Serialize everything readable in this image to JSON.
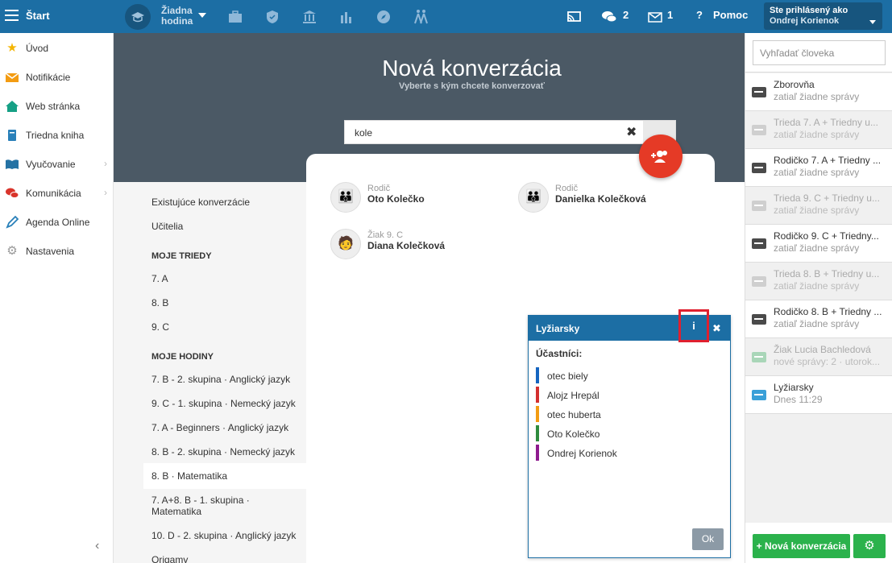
{
  "topbar": {
    "start": "Štart",
    "hodina": [
      "Žiadna",
      "hodina"
    ],
    "messages_count": "2",
    "mail_count": "1",
    "help": "Pomoc",
    "login_label": "Ste prihlásený ako",
    "login_user": "Ondrej Korienok"
  },
  "nav": [
    {
      "label": "Úvod",
      "icon": "star-icon",
      "color": "#f4b400"
    },
    {
      "label": "Notifikácie",
      "icon": "envelope-icon",
      "color": "#f39c12"
    },
    {
      "label": "Web stránka",
      "icon": "home-icon",
      "color": "#16a085"
    },
    {
      "label": "Triedna kniha",
      "icon": "book-icon",
      "color": "#2980b9"
    },
    {
      "label": "Vyučovanie",
      "icon": "open-book-icon",
      "color": "#2472a4"
    },
    {
      "label": "Komunikácia",
      "icon": "chat-icon",
      "color": "#d9342b"
    },
    {
      "label": "Agenda Online",
      "icon": "pen-icon",
      "color": "#2980b9"
    },
    {
      "label": "Nastavenia",
      "icon": "gear-icon",
      "color": "#999999"
    }
  ],
  "hero": {
    "title": "Nová konverzácia",
    "subtitle": "Vyberte s kým chcete konverzovať"
  },
  "search": {
    "value": "kole"
  },
  "sublist": {
    "existing": "Existujúce konverzácie",
    "teachers": "Učitelia",
    "classes_head": "MOJE TRIEDY",
    "classes": [
      "7. A",
      "8. B",
      "9. C"
    ],
    "lessons_head": "MOJE HODINY",
    "lessons": [
      "7. B - 2. skupina · Anglický jazyk",
      "9. C - 1. skupina · Nemecký jazyk",
      "7. A - Beginners · Anglický jazyk",
      "8. B - 2. skupina · Nemecký jazyk",
      "8. B · Matematika",
      "7. A+8. B - 1. skupina ·",
      "Matematika",
      "10. D - 2. skupina · Anglický jazyk",
      "Origamy"
    ]
  },
  "results": [
    {
      "role": "Rodič",
      "name": "Oto Kolečko"
    },
    {
      "role": "Rodič",
      "name": "Danielka Kolečková"
    },
    {
      "role": "Žiak 9. C",
      "name": "Diana Kolečková"
    }
  ],
  "dialog": {
    "title": "Lyžiarsky",
    "info": "i",
    "close": "✖",
    "participants_head": "Účastníci:",
    "participants": [
      {
        "name": "otec biely",
        "color": "#1565c0"
      },
      {
        "name": "Alojz Hrepál",
        "color": "#d32f2f"
      },
      {
        "name": "otec huberta",
        "color": "#f39c12"
      },
      {
        "name": "Oto Kolečko",
        "color": "#2e8b3d"
      },
      {
        "name": "Ondrej Korienok",
        "color": "#8e1a8e"
      }
    ],
    "ok": "Ok"
  },
  "right": {
    "search_placeholder": "Vyhľadať človeka",
    "conversations": [
      {
        "title": "Zborovňa",
        "sub": "zatiaľ žiadne správy",
        "style": "normal"
      },
      {
        "title": "Trieda 7. A + Triedny u...",
        "sub": "zatiaľ žiadne správy",
        "style": "dim"
      },
      {
        "title": "Rodičko 7. A + Triedny ...",
        "sub": "zatiaľ žiadne správy",
        "style": "normal"
      },
      {
        "title": "Trieda 9. C + Triedny u...",
        "sub": "zatiaľ žiadne správy",
        "style": "dim"
      },
      {
        "title": "Rodičko 9. C + Triedny...",
        "sub": "zatiaľ žiadne správy",
        "style": "normal"
      },
      {
        "title": "Trieda 8. B + Triedny u...",
        "sub": "zatiaľ žiadne správy",
        "style": "dim"
      },
      {
        "title": "Rodičko 8. B + Triedny ...",
        "sub": "zatiaľ žiadne správy",
        "style": "normal"
      },
      {
        "title": "Žiak Lucia Bachledová",
        "sub": "nové správy: 2 · utorok...",
        "style": "green"
      },
      {
        "title": "Lyžiarsky",
        "sub": "Dnes 11:29",
        "style": "active"
      }
    ],
    "new_button": "+ Nová konverzácia"
  }
}
